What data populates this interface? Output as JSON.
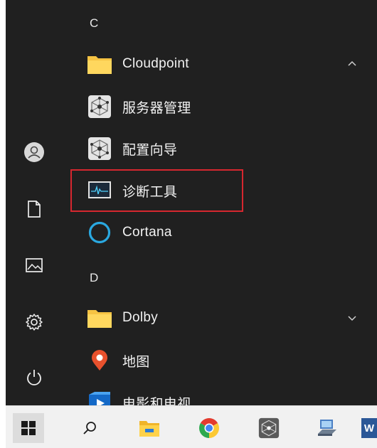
{
  "start_menu": {
    "groups": {
      "c": "C",
      "d": "D"
    },
    "items": {
      "cloudpoint": "Cloudpoint",
      "server_mgmt": "服务器管理",
      "config_wizard": "配置向导",
      "diag_tool": "诊断工具",
      "cortana": "Cortana",
      "dolby": "Dolby",
      "maps": "地图",
      "movies_tv": "电影和电视"
    },
    "rail": [
      "user-avatar-icon",
      "document-icon",
      "pictures-icon",
      "settings-icon",
      "power-icon"
    ]
  },
  "taskbar": {
    "word_label": "W",
    "icons": [
      "windows-logo-icon",
      "search-icon",
      "file-explorer-icon",
      "chrome-icon",
      "cloudpoint-app-icon",
      "network-computer-icon",
      "word-icon"
    ]
  },
  "colors": {
    "menu_bg": "#202020",
    "highlight_border": "#d6272f",
    "folder": "#f6c343",
    "cortana": "#2aa8e0",
    "taskbar_bg": "#f1f1f1"
  }
}
